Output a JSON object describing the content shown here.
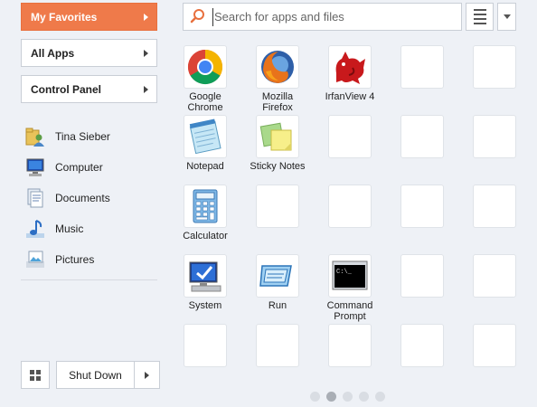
{
  "categories": [
    {
      "label": "My Favorites",
      "active": true
    },
    {
      "label": "All Apps",
      "active": false
    },
    {
      "label": "Control Panel",
      "active": false
    }
  ],
  "places": [
    {
      "label": "Tina Sieber",
      "icon": "user-folder-icon"
    },
    {
      "label": "Computer",
      "icon": "computer-icon"
    },
    {
      "label": "Documents",
      "icon": "documents-icon"
    },
    {
      "label": "Music",
      "icon": "music-icon"
    },
    {
      "label": "Pictures",
      "icon": "pictures-icon"
    }
  ],
  "search": {
    "placeholder": "Search for apps and files",
    "value": ""
  },
  "power": {
    "shutdown_label": "Shut Down"
  },
  "apps": [
    {
      "line1": "Google",
      "line2": "Chrome",
      "icon": "chrome-icon"
    },
    {
      "line1": "Mozilla",
      "line2": "Firefox",
      "icon": "firefox-icon"
    },
    {
      "line1": "IrfanView 4",
      "line2": "",
      "icon": "irfanview-icon"
    },
    {
      "line1": "Notepad",
      "line2": "",
      "icon": "notepad-icon"
    },
    {
      "line1": "Sticky Notes",
      "line2": "",
      "icon": "sticky-notes-icon"
    },
    {
      "line1": "Calculator",
      "line2": "",
      "icon": "calculator-icon"
    },
    {
      "line1": "System",
      "line2": "",
      "icon": "system-icon"
    },
    {
      "line1": "Run",
      "line2": "",
      "icon": "run-icon"
    },
    {
      "line1": "Command",
      "line2": "Prompt",
      "icon": "command-prompt-icon"
    }
  ],
  "pager": {
    "pages": 5,
    "current": 2
  },
  "colors": {
    "accent": "#ef7a4a",
    "background": "#eef1f6"
  }
}
